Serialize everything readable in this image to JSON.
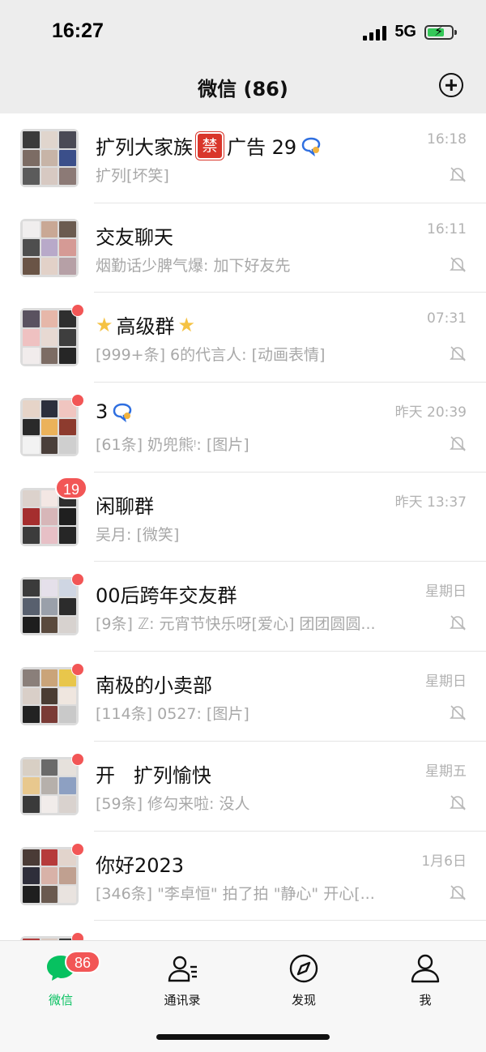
{
  "status_bar": {
    "time": "16:27",
    "network": "5G"
  },
  "header": {
    "title": "微信 (86)"
  },
  "chats": [
    {
      "title": "扩列大家族",
      "title_suffix": "广告 29",
      "ban_icon_text": "禁",
      "time": "16:18",
      "preview": "扩列[坏笑]",
      "muted": true
    },
    {
      "title": "交友聊天",
      "time": "16:11",
      "preview": "烟勤话少脾气爆: 加下好友先",
      "muted": true
    },
    {
      "title": "高级群",
      "time": "07:31",
      "preview": "[999+条] 6的代言人: [动画表情]",
      "muted": true
    },
    {
      "title": "3",
      "time": "昨天 20:39",
      "preview": "[61条] 奶兜熊ᵎ: [图片]",
      "muted": true
    },
    {
      "title": "闲聊群",
      "time": "昨天 13:37",
      "preview": "吴月: [微笑]",
      "badge_count": "19",
      "muted": false
    },
    {
      "title": "00后跨年交友群",
      "time": "星期日",
      "preview": "[9条] ℤ: 元宵节快乐呀[爱心] 团团圆圆...",
      "muted": true
    },
    {
      "title": "南极的小卖部",
      "time": "星期日",
      "preview": "[114条] 0527: [图片]",
      "muted": true
    },
    {
      "title": "开   扩列愉快",
      "time": "星期五",
      "preview": "[59条] 修勾来啦: 没人",
      "muted": true
    },
    {
      "title": "你好2023",
      "time": "1月6日",
      "preview": "[346条] \"李卓恒\" 拍了拍 \"静心\" 开心[...",
      "muted": true
    }
  ],
  "tabbar": {
    "tabs": [
      {
        "label": "微信",
        "icon": "chat-bubble-icon",
        "active": true,
        "badge": "86"
      },
      {
        "label": "通讯录",
        "icon": "contacts-icon",
        "active": false
      },
      {
        "label": "发现",
        "icon": "compass-icon",
        "active": false
      },
      {
        "label": "我",
        "icon": "person-icon",
        "active": false
      }
    ]
  },
  "colors": {
    "accent": "#07c160",
    "badge": "#f25656",
    "header_bg": "#ededed"
  }
}
